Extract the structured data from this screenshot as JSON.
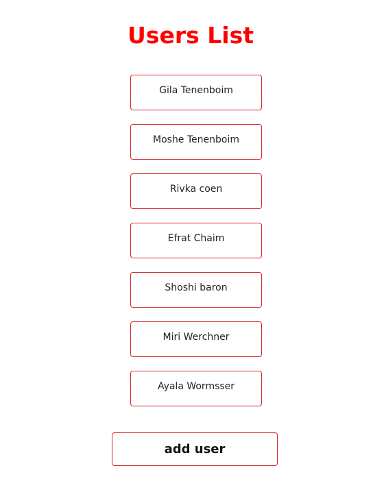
{
  "header": {
    "title": "Users List"
  },
  "users": [
    {
      "name": "Gila Tenenboim"
    },
    {
      "name": "Moshe Tenenboim"
    },
    {
      "name": "Rivka coen"
    },
    {
      "name": "Efrat Chaim"
    },
    {
      "name": "Shoshi baron"
    },
    {
      "name": "Miri Werchner"
    },
    {
      "name": "Ayala Wormsser"
    }
  ],
  "actions": {
    "add_user_label": "add user"
  },
  "colors": {
    "title": "#ff0000",
    "card_border": "#d9262b",
    "background": "#ffffff"
  }
}
